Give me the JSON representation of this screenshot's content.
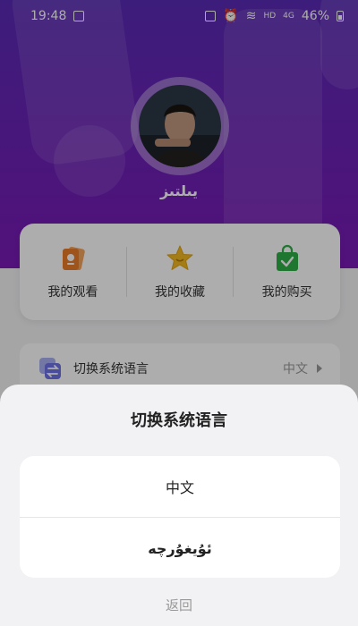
{
  "status_bar": {
    "time": "19:48",
    "network": "HD",
    "signal": "4G",
    "battery": "46%"
  },
  "profile": {
    "username": "يىلتىز"
  },
  "shortcuts": [
    {
      "label": "我的观看",
      "icon": "watch-history-icon"
    },
    {
      "label": "我的收藏",
      "icon": "star-icon"
    },
    {
      "label": "我的购买",
      "icon": "shopping-bag-icon"
    }
  ],
  "language_row": {
    "label": "切换系统语言",
    "value": "中文",
    "icon": "language-switch-icon"
  },
  "sheet": {
    "title": "切换系统语言",
    "options": [
      "中文",
      "ئۇيغۇرچە"
    ],
    "cancel": "返回"
  },
  "colors": {
    "header_top": "#5a2bb5",
    "header_bottom": "#7a1ab6",
    "star": "#f2b822",
    "bag": "#2fae45",
    "watch": "#ea7c2a",
    "lang_icon": "#6d70e6"
  }
}
